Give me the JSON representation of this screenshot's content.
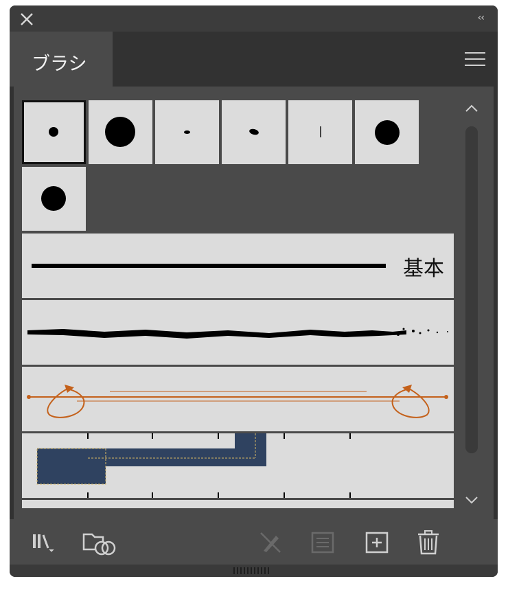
{
  "panel": {
    "tab_label": "ブラシ"
  },
  "brushes": {
    "row_labels": [
      "基本"
    ]
  },
  "icons": {
    "close": "close-icon",
    "collapse": "collapse-chevrons-icon",
    "menu": "hamburger-menu-icon",
    "library": "brush-library-icon",
    "cc_library": "cc-libraries-icon",
    "remove_stroke": "remove-brush-stroke-icon",
    "options": "brush-options-icon",
    "new": "new-brush-icon",
    "delete": "delete-brush-icon"
  },
  "colors": {
    "panel_bg": "#323232",
    "content_bg": "#4a4a4a",
    "swatch_bg": "#dcdcdc",
    "orange": "#c4611b"
  }
}
